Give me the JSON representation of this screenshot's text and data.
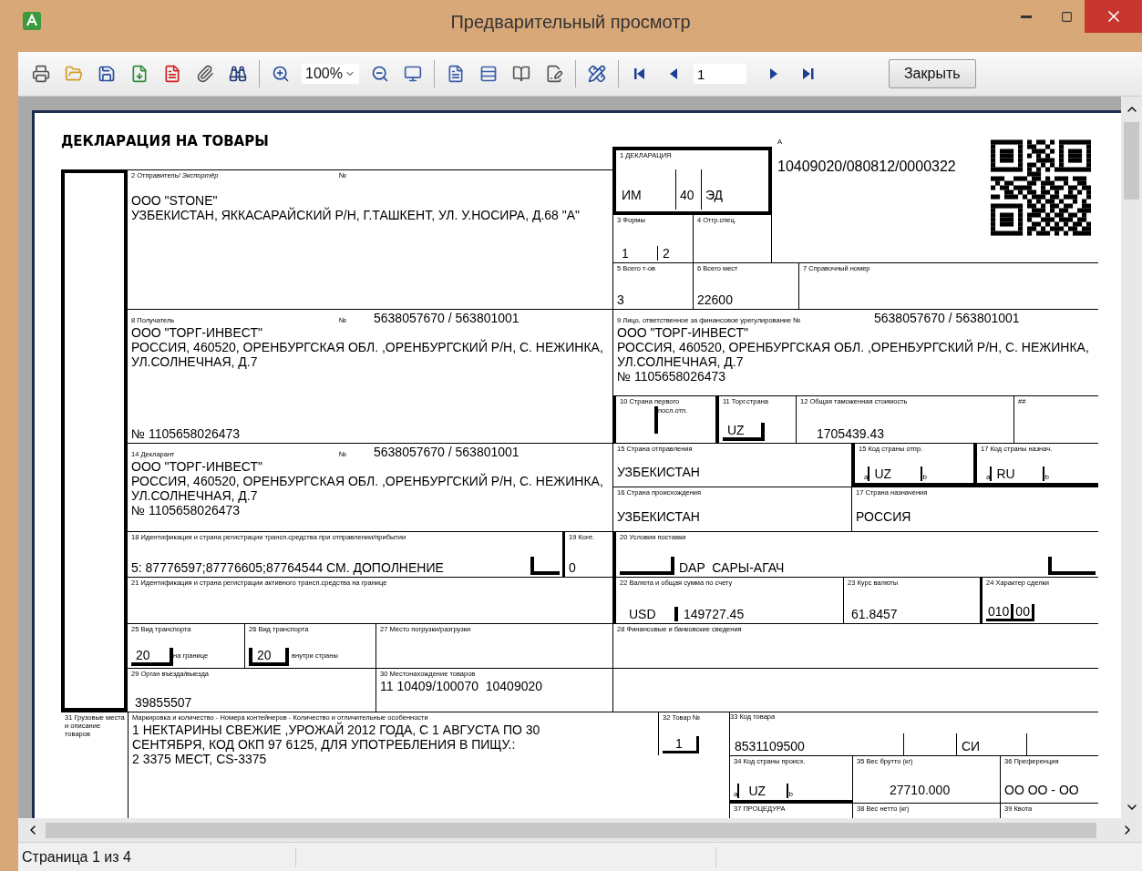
{
  "window": {
    "title": "Предварительный просмотр"
  },
  "toolbar": {
    "zoom": "100%",
    "page": "1",
    "close_button": "Закрыть"
  },
  "document": {
    "title": "ДЕКЛАРАЦИЯ НА ТОВАРЫ",
    "box_1": {
      "label": "1 ДЕКЛАРАЦИЯ",
      "values": [
        "ИМ",
        "40",
        "ЭД"
      ]
    },
    "box_a": {
      "label": "А",
      "value": "10409020/080812/0000322"
    },
    "box_2": {
      "label": "2 Отправитель/ *Экспортёр*",
      "number_label": "№",
      "lines": [
        "ООО \"STONE\"",
        "УЗБЕКИСТАН, ЯККАСАРАЙСКИЙ Р/Н, Г.ТАШКЕНТ, УЛ. У.НОСИРА, Д.68 \"А\""
      ]
    },
    "box_3": {
      "label": "3 Формы",
      "values": [
        "1",
        "2"
      ]
    },
    "box_4": {
      "label": "4 Отгр.спец."
    },
    "box_5": {
      "label": "5 Всего т-ов",
      "value": "3"
    },
    "box_6": {
      "label": "6 Всего мест",
      "value": "22600"
    },
    "box_7": {
      "label": "7 Справочный номер"
    },
    "box_8": {
      "label": "8 Получатель",
      "number_label": "№",
      "number": "5638057670 / 563801001",
      "lines": [
        "ООО \"ТОРГ-ИНВЕСТ\"",
        "РОССИЯ, 460520, ОРЕНБУРГСКАЯ ОБЛ. ,ОРЕНБУРГСКИЙ Р/Н, С. НЕЖИНКА, УЛ.СОЛНЕЧНАЯ, Д.7"
      ],
      "registration": "№ 1105658026473"
    },
    "box_9": {
      "label": "9 Лицо, ответственное за финансовое урегулирование №",
      "number": "5638057670 / 563801001",
      "lines": [
        "ООО \"ТОРГ-ИНВЕСТ\"",
        "РОССИЯ, 460520, ОРЕНБУРГСКАЯ ОБЛ. ,ОРЕНБУРГСКИЙ Р/Н, С. НЕЖИНКА, УЛ.СОЛНЕЧНАЯ, Д.7"
      ],
      "registration": "№ 1105658026473"
    },
    "box_10": {
      "label": "10 Страна первого",
      "label_2": "посл.отп."
    },
    "box_11": {
      "label": "11 Торг.страна",
      "value": "UZ"
    },
    "box_12": {
      "label": "12 Общая таможенная стоимость",
      "value": "1705439.43"
    },
    "hash_box": {
      "label": "##"
    },
    "box_14": {
      "label": "14 Декларант",
      "number_label": "№",
      "number": "5638057670 / 563801001",
      "lines": [
        "ООО \"ТОРГ-ИНВЕСТ\"",
        "РОССИЯ, 460520, ОРЕНБУРГСКАЯ ОБЛ. ,ОРЕНБУРГСКИЙ Р/Н, С. НЕЖИНКА, УЛ.СОЛНЕЧНАЯ, Д.7"
      ],
      "registration": "№ 1105658026473"
    },
    "box_15": {
      "label": "15 Страна отправления",
      "value": "УЗБЕКИСТАН"
    },
    "box_15_code": {
      "label": "15 Код страны отпр.",
      "value": "UZ",
      "sub_a": "a",
      "sub_b": "b"
    },
    "box_17_code": {
      "label": "17 Код страны назнач.",
      "value": "RU",
      "sub_a": "a",
      "sub_b": "b"
    },
    "box_16": {
      "label": "16 Страна происхождения",
      "value": "УЗБЕКИСТАН"
    },
    "box_17": {
      "label": "17 Страна назначения",
      "value": "РОССИЯ"
    },
    "box_18": {
      "label": "18 Идентификация и страна регистрации трансп.средства при отправлении/прибытии",
      "value": "5: 87776597;87776605;87764544 СМ. ДОПОЛНЕНИЕ"
    },
    "box_19": {
      "label": "19 Конт.",
      "value": "0"
    },
    "box_20": {
      "label": "20 Условия поставки",
      "values": [
        "DAP",
        "САРЫ-АГАЧ"
      ]
    },
    "box_21": {
      "label": "21 Идентификация и страна регистрации активного трансп.средства на границе"
    },
    "box_22": {
      "label": "22 Валюта и общая сумма по счету",
      "currency": "USD",
      "amount": "149727.45"
    },
    "box_23": {
      "label": "23 Курс валюты",
      "value": "61.8457"
    },
    "box_24": {
      "label": "24 Характер сделки",
      "values": [
        "010",
        "00"
      ]
    },
    "box_25": {
      "label": "25 Вид транспорта",
      "value": "20",
      "note": "на границе"
    },
    "box_26": {
      "label": "26 Вид транспорта",
      "value": "20",
      "note": "внутри страны"
    },
    "box_27": {
      "label": "27 Место погрузки/разгрузки"
    },
    "box_28": {
      "label": "28 Финансовые и банковские сведения"
    },
    "box_29": {
      "label": "29 Орган въезда/выезда",
      "value": "39855507"
    },
    "box_30": {
      "label": "30 Местонахождение товаров",
      "value": "11 10409/100070  10409020"
    },
    "box_31": {
      "label": "31 Грузовые места и описание товаров",
      "header": "Маркировка и количество - Номера контейнеров - Количество и отличительные особенности",
      "lines": [
        "1 НЕКТАРИНЫ СВЕЖИЕ ,УРОЖАЙ 2012 ГОДА, С 1 АВГУСТА ПО 30 СЕНТЯБРЯ, КОД ОКП 97 6125, ДЛЯ УПОТРЕБЛЕНИЯ В ПИЩУ.:",
        "2  3375 МЕСТ, CS-3375"
      ]
    },
    "box_32": {
      "label": "32 Товар",
      "number_label": "№",
      "value": "1"
    },
    "box_33": {
      "label": "33 Код товара",
      "values": [
        "8531109500",
        "СИ"
      ]
    },
    "box_34": {
      "label": "34 Код страны происх.",
      "value": "UZ",
      "sub_a": "a",
      "sub_b": "b"
    },
    "box_35": {
      "label": "35 Вес брутто (кг)",
      "value": "27710.000"
    },
    "box_36": {
      "label": "36 Преференция",
      "value": "ОО ОО - ОО"
    },
    "box_37": {
      "label": "37 ПРОЦЕДУРА"
    },
    "box_38": {
      "label": "38 Вес нетто (кг)"
    },
    "box_39": {
      "label": "39 Квота"
    }
  },
  "status_bar": {
    "page": "Страница 1 из 4"
  }
}
